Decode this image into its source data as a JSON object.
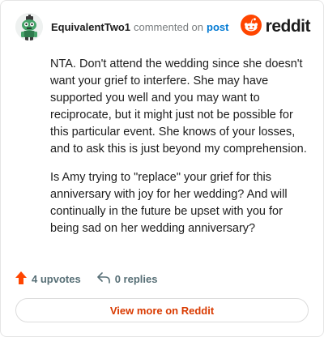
{
  "header": {
    "username": "EquivalentTwo1",
    "action_text": "commented on",
    "post_link": "post",
    "brand": "reddit"
  },
  "comment": {
    "paragraphs": [
      "NTA. Don't attend the wedding since she doesn't want your grief to interfere. She may have supported you well and you may want to reciprocate, but it might just not be possible for this particular event. She knows of your losses, and to ask this is just beyond my comprehension.",
      "Is Amy trying to \"replace\" your grief for this anniversary with joy for her wedding? And will continually in the future be upset with you for being sad on her wedding anniversary?"
    ]
  },
  "stats": {
    "upvotes_label": "4 upvotes",
    "replies_label": "0 replies"
  },
  "footer": {
    "view_more_label": "View more on Reddit"
  },
  "colors": {
    "brand_orange": "#ff4500",
    "link_blue": "#0079d3",
    "cta_orange": "#d93a00",
    "upvote_orange": "#ff4500"
  },
  "icons": {
    "avatar": "snoo-avatar-icon",
    "brand": "reddit-logo-icon",
    "upvote": "upvote-arrow-icon",
    "reply": "reply-arrow-icon"
  }
}
